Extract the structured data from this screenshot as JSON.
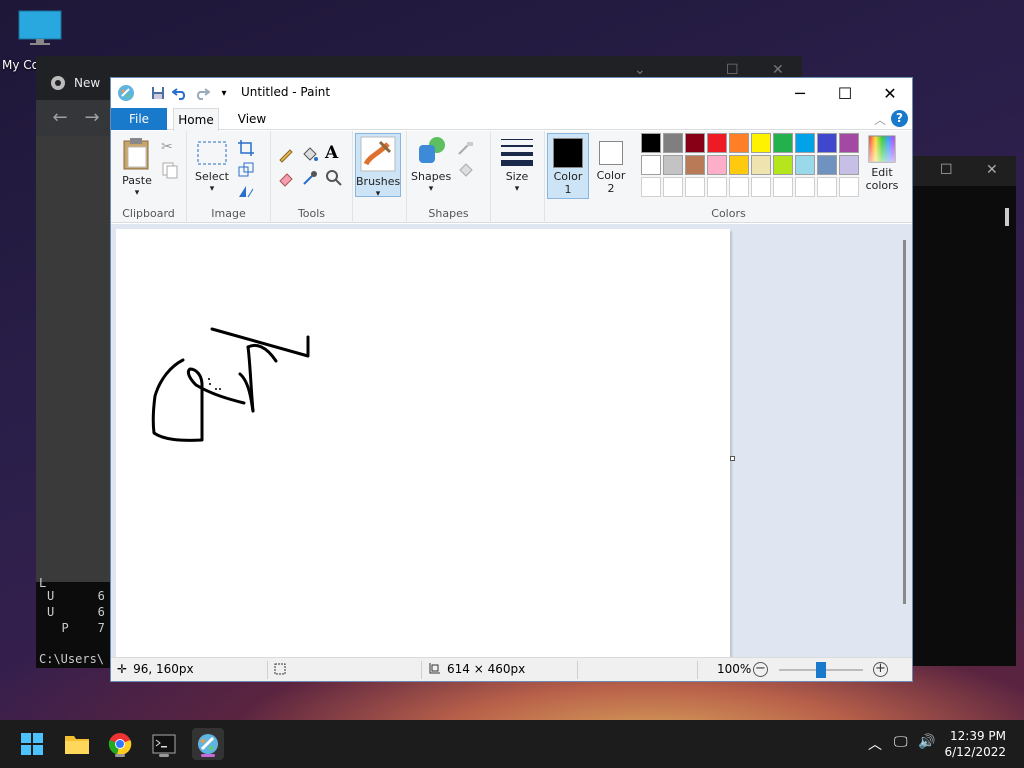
{
  "desktop": {
    "icon_label": "My Co"
  },
  "chrome": {
    "tab_label": "New"
  },
  "terminal": {
    "lines": [
      "L",
      "U      6",
      "U      6",
      "  P    7"
    ],
    "prompt": "C:\\Users\\"
  },
  "paint": {
    "title": "Untitled - Paint",
    "menu": {
      "file": "File",
      "home": "Home",
      "view": "View"
    },
    "groups": {
      "clipboard": "Clipboard",
      "image": "Image",
      "tools": "Tools",
      "shapes": "Shapes",
      "colors": "Colors"
    },
    "buttons": {
      "paste": "Paste",
      "select": "Select",
      "brushes": "Brushes",
      "shapes": "Shapes",
      "size": "Size",
      "color1_line1": "Color",
      "color1_line2": "1",
      "color2_line1": "Color",
      "color2_line2": "2",
      "edit_colors_line1": "Edit",
      "edit_colors_line2": "colors"
    },
    "color1": "#000000",
    "color2": "#ffffff",
    "palette_row1": [
      "#000000",
      "#7f7f7f",
      "#880015",
      "#ed1c24",
      "#ff7f27",
      "#fff200",
      "#22b14c",
      "#00a2e8",
      "#3f48cc",
      "#a349a4"
    ],
    "palette_row2": [
      "#ffffff",
      "#c3c3c3",
      "#b97a57",
      "#ffaec9",
      "#ffc90e",
      "#efe4b0",
      "#b5e61d",
      "#99d9ea",
      "#7092be",
      "#c8bfe7"
    ],
    "status": {
      "cursor_pos": "96, 160px",
      "canvas_size": "614 × 460px",
      "zoom": "100%",
      "zoom_fraction": 0.5
    }
  },
  "taskbar": {
    "time": "12:39 PM",
    "date": "6/12/2022"
  }
}
